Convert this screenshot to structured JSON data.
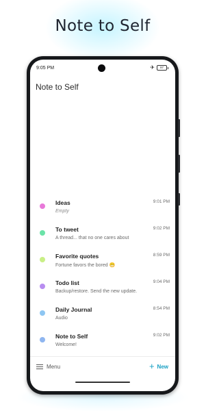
{
  "header": {
    "title": "Note to Self"
  },
  "status_bar": {
    "time": "9:05 PM",
    "battery": "97",
    "icons": [
      "airplane-icon",
      "battery-icon"
    ]
  },
  "screen": {
    "title": "Note to Self"
  },
  "notes": [
    {
      "title": "Ideas",
      "preview": "Empty",
      "time": "9:01 PM",
      "color": "#e879d9",
      "empty": true
    },
    {
      "title": "To tweet",
      "preview": "A thread... that no one cares about",
      "time": "9:02 PM",
      "color": "#6be3a8"
    },
    {
      "title": "Favorite quotes",
      "preview": "Fortune favors the bored 😁",
      "time": "8:59 PM",
      "color": "#c9ef86"
    },
    {
      "title": "Todo list",
      "preview": "Backup/restore. Send the new update.",
      "time": "9:04 PM",
      "color": "#b88df0"
    },
    {
      "title": "Daily Journal",
      "preview": "Audio",
      "time": "8:54 PM",
      "color": "#8ec6f2"
    },
    {
      "title": "Note to Self",
      "preview": "Welcome!",
      "time": "9:02 PM",
      "color": "#8fb6f0"
    }
  ],
  "bottom_bar": {
    "menu_label": "Menu",
    "new_label": "New"
  },
  "colors": {
    "accent": "#1aa0c4"
  }
}
